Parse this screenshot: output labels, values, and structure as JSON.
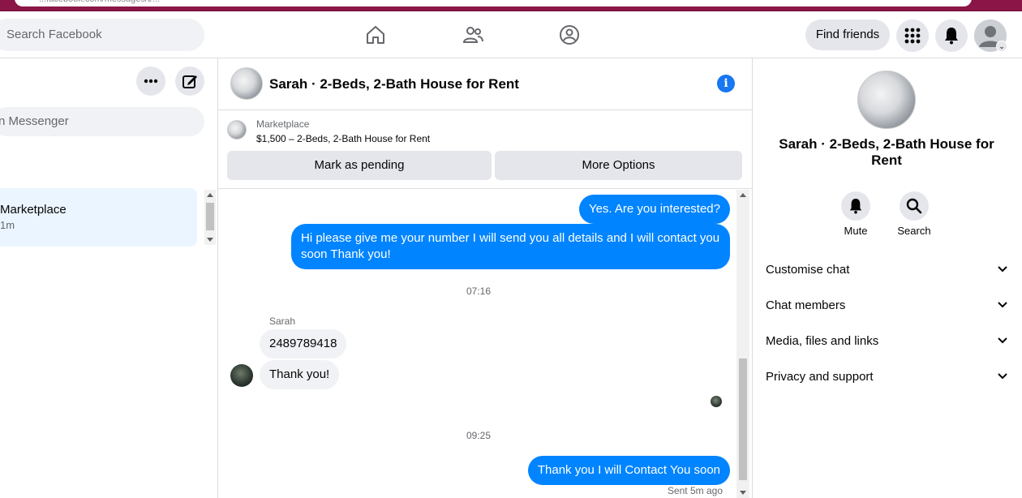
{
  "browser": {
    "url_fragment": "...facebook.com/messages/t/..."
  },
  "topbar": {
    "search_placeholder": "Search Facebook",
    "find_friends": "Find friends",
    "icons": [
      "home-icon",
      "friends-icon",
      "groups-icon",
      "menu-grid-icon",
      "bell-icon",
      "account-avatar"
    ]
  },
  "left": {
    "search_placeholder": "n Messenger",
    "conversation": {
      "title": "Marketplace",
      "time": "1m"
    }
  },
  "chat": {
    "title": "Sarah · 2-Beds, 2-Bath House for Rent",
    "marketplace_label": "Marketplace",
    "listing": "$1,500 – 2-Beds, 2-Bath House for Rent",
    "mark_pending": "Mark as pending",
    "more_options": "More Options",
    "messages": {
      "m1": "Yes. Are you interested?",
      "m2": "Hi please give me your number I will send you all details and I will contact you soon Thank you!",
      "time1": "07:16",
      "sender": "Sarah",
      "m3": "2489789418",
      "m4": "Thank you!",
      "time2": "09:25",
      "m5": "Thank you I will Contact You soon",
      "status": "Sent 5m ago"
    }
  },
  "right": {
    "title": "Sarah · 2-Beds, 2-Bath House for Rent",
    "mute": "Mute",
    "search": "Search",
    "sections": [
      "Customise chat",
      "Chat members",
      "Media, files and links",
      "Privacy and support"
    ]
  },
  "colors": {
    "accent": "#0084ff",
    "info": "#1877f2",
    "chrome": "#8a1546"
  }
}
